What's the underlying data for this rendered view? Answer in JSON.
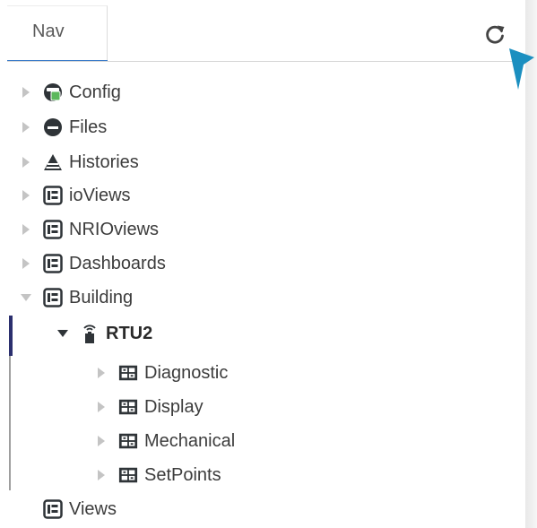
{
  "header": {
    "tab_label": "Nav",
    "refresh_icon": "refresh-icon"
  },
  "tree": {
    "items": [
      {
        "label": "Config",
        "icon": "config-icon",
        "expanded": false
      },
      {
        "label": "Files",
        "icon": "files-icon",
        "expanded": false
      },
      {
        "label": "Histories",
        "icon": "histories-icon",
        "expanded": false
      },
      {
        "label": "ioViews",
        "icon": "view-icon",
        "expanded": false
      },
      {
        "label": "NRIOviews",
        "icon": "view-icon",
        "expanded": false
      },
      {
        "label": "Dashboards",
        "icon": "view-icon",
        "expanded": false
      },
      {
        "label": "Building",
        "icon": "view-icon",
        "expanded": true,
        "children": [
          {
            "label": "RTU2",
            "icon": "device-icon",
            "expanded": true,
            "selected": true,
            "children": [
              {
                "label": "Diagnostic",
                "icon": "folder-grid-icon"
              },
              {
                "label": "Display",
                "icon": "folder-grid-icon"
              },
              {
                "label": "Mechanical",
                "icon": "folder-grid-icon"
              },
              {
                "label": "SetPoints",
                "icon": "folder-grid-icon"
              }
            ]
          }
        ]
      },
      {
        "label": "Views",
        "icon": "view-icon"
      }
    ]
  },
  "colors": {
    "accent": "#3a7bc8",
    "selection_bar": "#2b2f6e",
    "cursor": "#1b8fc0",
    "icon_dark": "#2f3438",
    "icon_green": "#5cb85c"
  }
}
